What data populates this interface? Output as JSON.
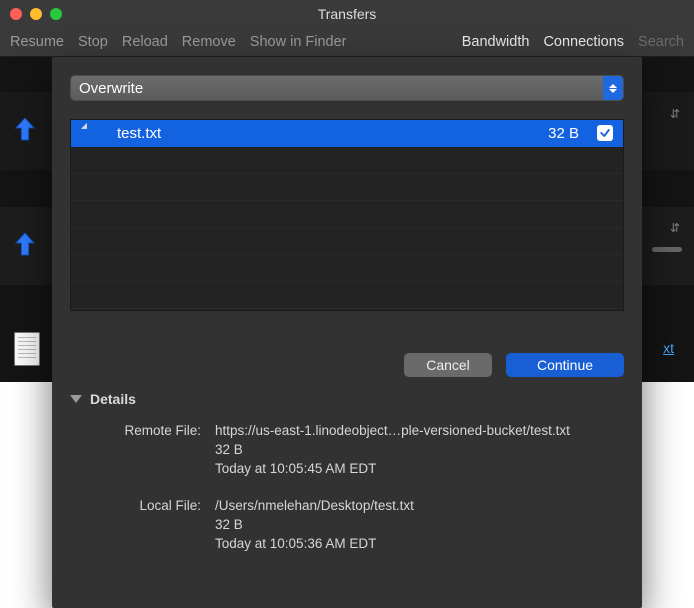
{
  "window": {
    "title": "Transfers"
  },
  "toolbar": {
    "left": [
      "Resume",
      "Stop",
      "Reload",
      "Remove",
      "Show in Finder"
    ],
    "right": [
      "Bandwidth",
      "Connections",
      "Search"
    ]
  },
  "background": {
    "link_text": "xt"
  },
  "sheet": {
    "dropdown": {
      "selected": "Overwrite"
    },
    "files": [
      {
        "name": "test.txt",
        "size": "32 B",
        "checked": true,
        "selected": true
      }
    ],
    "buttons": {
      "cancel": "Cancel",
      "continue": "Continue"
    },
    "details": {
      "header": "Details",
      "remote_label": "Remote File:",
      "remote": {
        "path": "https://us-east-1.linodeobject…ple-versioned-bucket/test.txt",
        "size": "32 B",
        "time": "Today at 10:05:45 AM EDT"
      },
      "local_label": "Local File:",
      "local": {
        "path": "/Users/nmelehan/Desktop/test.txt",
        "size": "32 B",
        "time": "Today at 10:05:36 AM EDT"
      }
    }
  }
}
